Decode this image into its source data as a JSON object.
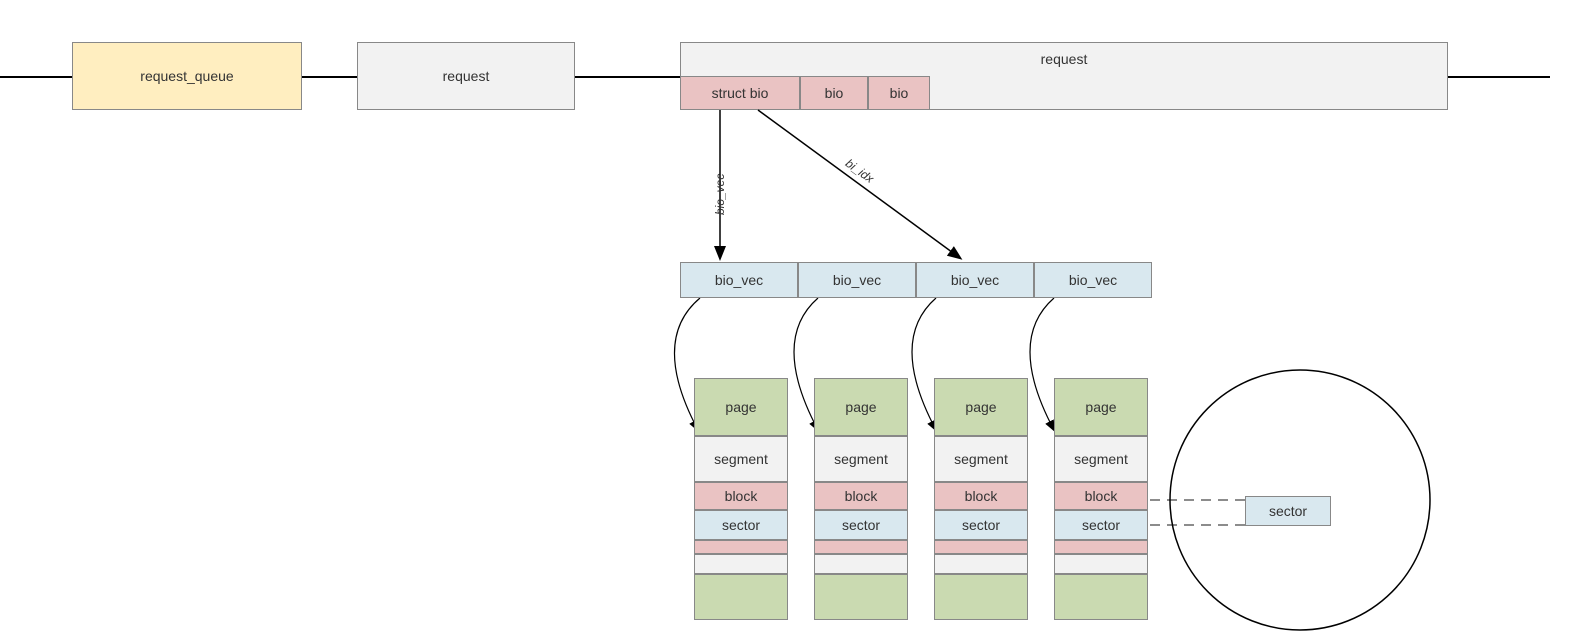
{
  "top": {
    "request_queue": "request_queue",
    "request1": "request",
    "request2": "request",
    "struct_bio": "struct bio",
    "bio1": "bio",
    "bio2": "bio"
  },
  "arrows": {
    "bio_vec_label": "bio_vec",
    "bi_idx_label": "bi_idx"
  },
  "biovec": {
    "v1": "bio_vec",
    "v2": "bio_vec",
    "v3": "bio_vec",
    "v4": "bio_vec"
  },
  "stack": {
    "page": "page",
    "segment": "segment",
    "block": "block",
    "sector": "sector"
  },
  "disk": {
    "sector": "sector"
  }
}
